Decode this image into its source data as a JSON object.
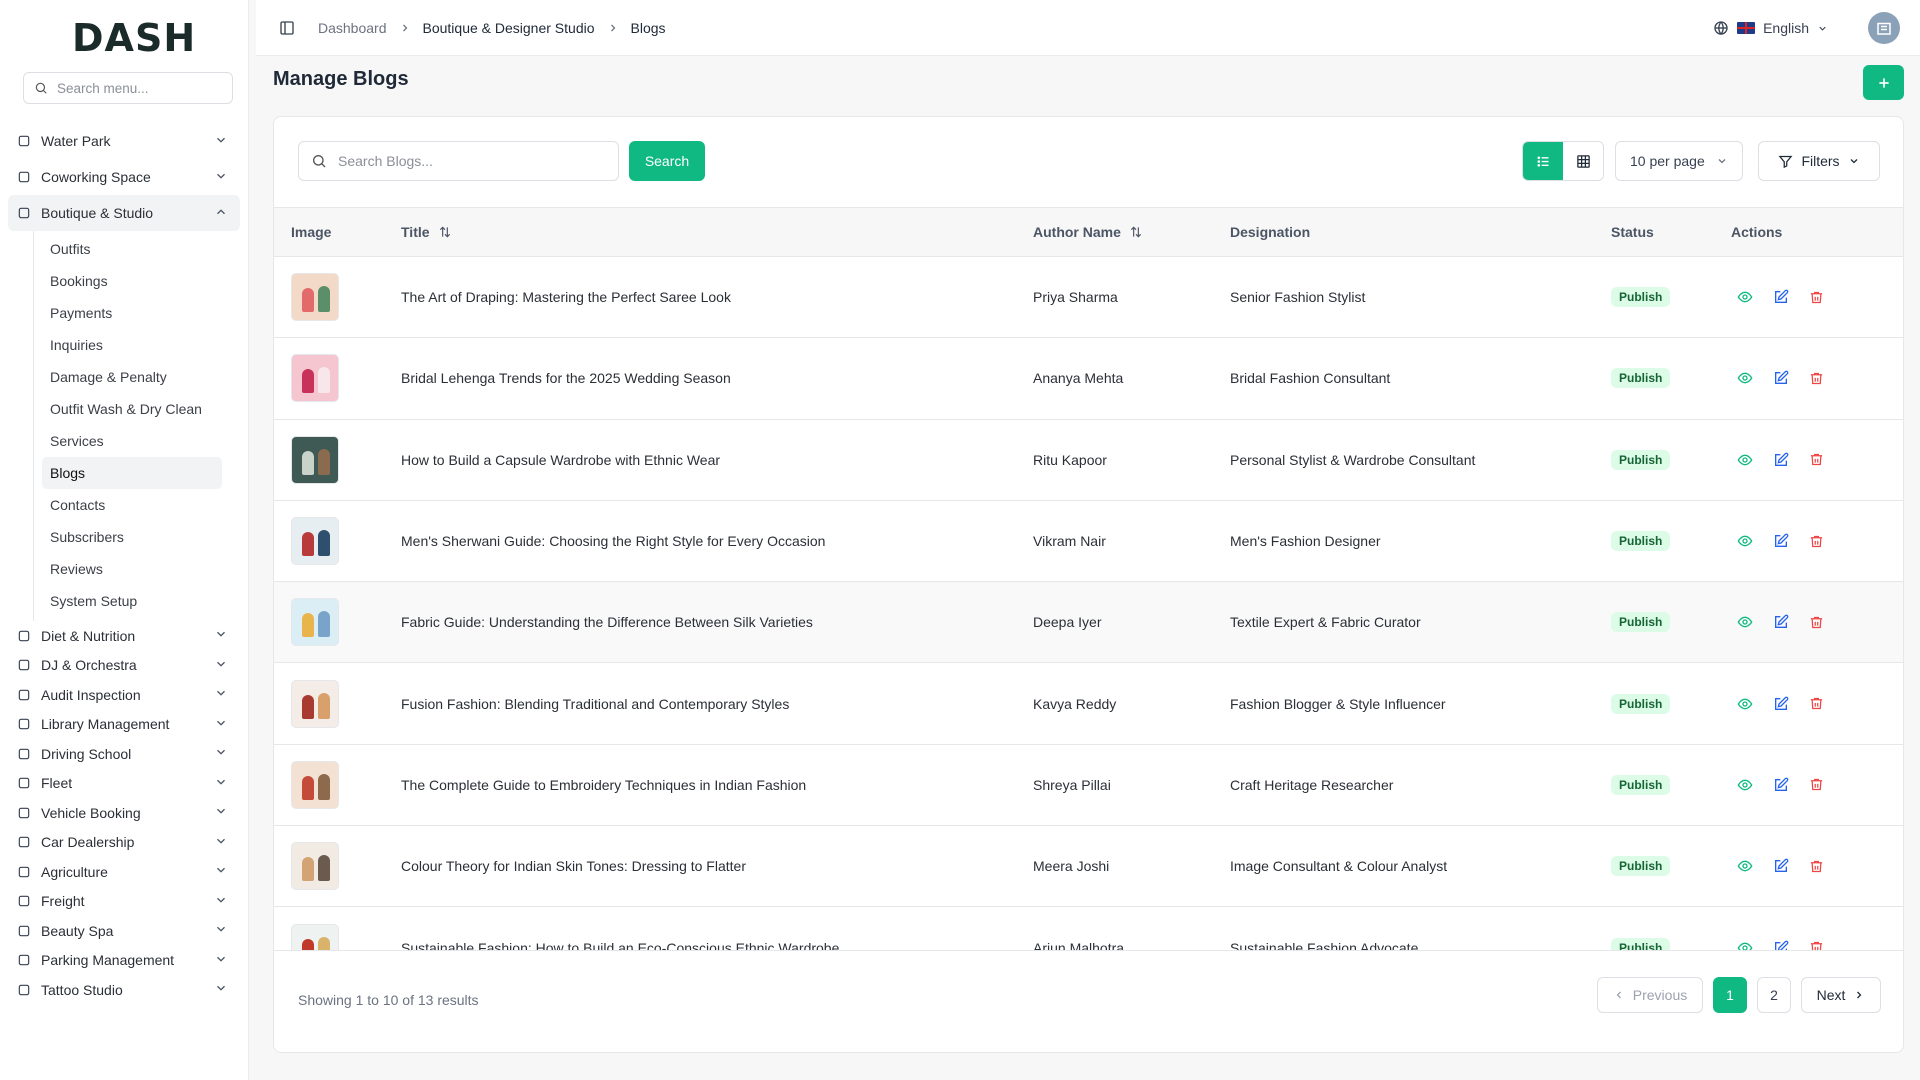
{
  "app": {
    "logo": "DASH"
  },
  "sidebar": {
    "search_placeholder": "Search menu...",
    "top_items": [
      {
        "label": "Water Park",
        "icon": "waves-icon"
      },
      {
        "label": "Coworking Space",
        "icon": "wifi-icon"
      }
    ],
    "active_group": {
      "label": "Boutique & Studio",
      "icon": "shirt-icon"
    },
    "sub_items": [
      {
        "label": "Outfits"
      },
      {
        "label": "Bookings"
      },
      {
        "label": "Payments"
      },
      {
        "label": "Inquiries"
      },
      {
        "label": "Damage & Penalty"
      },
      {
        "label": "Outfit Wash & Dry Clean"
      },
      {
        "label": "Services"
      },
      {
        "label": "Blogs"
      },
      {
        "label": "Contacts"
      },
      {
        "label": "Subscribers"
      },
      {
        "label": "Reviews"
      },
      {
        "label": "System Setup"
      }
    ],
    "bottom_items": [
      {
        "label": "Diet & Nutrition",
        "icon": "apple-icon"
      },
      {
        "label": "DJ & Orchestra",
        "icon": "disc-icon"
      },
      {
        "label": "Audit Inspection",
        "icon": "search-check-icon"
      },
      {
        "label": "Library Management",
        "icon": "library-icon"
      },
      {
        "label": "Driving School",
        "icon": "steering-wheel-icon"
      },
      {
        "label": "Fleet",
        "icon": "bus-icon"
      },
      {
        "label": "Vehicle Booking",
        "icon": "ticket-icon"
      },
      {
        "label": "Car Dealership",
        "icon": "car-icon"
      },
      {
        "label": "Agriculture",
        "icon": "tractor-icon"
      },
      {
        "label": "Freight",
        "icon": "container-icon"
      },
      {
        "label": "Beauty Spa",
        "icon": "scissors-icon"
      },
      {
        "label": "Parking Management",
        "icon": "grid-icon"
      },
      {
        "label": "Tattoo Studio",
        "icon": "pen-tool-icon"
      }
    ]
  },
  "topbar": {
    "breadcrumb": [
      "Dashboard",
      "Boutique & Designer Studio",
      "Blogs"
    ],
    "language": "English"
  },
  "page": {
    "title": "Manage Blogs",
    "add_label": "+"
  },
  "toolbar": {
    "search_placeholder": "Search Blogs...",
    "search_button": "Search",
    "per_page": "10 per page",
    "filters": "Filters"
  },
  "table": {
    "columns": [
      "Image",
      "Title",
      "Author Name",
      "Designation",
      "Status",
      "Actions"
    ],
    "rows": [
      {
        "title": "The Art of Draping: Mastering the Perfect Saree Look",
        "author": "Priya Sharma",
        "designation": "Senior Fashion Stylist",
        "status": "Publish",
        "thumb_colors": [
          "#f3d9c7",
          "#e36a6a",
          "#5b8f6a"
        ]
      },
      {
        "title": "Bridal Lehenga Trends for the 2025 Wedding Season",
        "author": "Ananya Mehta",
        "designation": "Bridal Fashion Consultant",
        "status": "Publish",
        "thumb_colors": [
          "#f5c6d0",
          "#c8325a",
          "#f7e7ea"
        ]
      },
      {
        "title": "How to Build a Capsule Wardrobe with Ethnic Wear",
        "author": "Ritu Kapoor",
        "designation": "Personal Stylist & Wardrobe Consultant",
        "status": "Publish",
        "thumb_colors": [
          "#3f5a54",
          "#c9d3c9",
          "#8b6b4f"
        ]
      },
      {
        "title": "Men's Sherwani Guide: Choosing the Right Style for Every Occasion",
        "author": "Vikram Nair",
        "designation": "Men's Fashion Designer",
        "status": "Publish",
        "thumb_colors": [
          "#e6eef2",
          "#b93a3a",
          "#2f4f6f"
        ]
      },
      {
        "title": "Fabric Guide: Understanding the Difference Between Silk Varieties",
        "author": "Deepa Iyer",
        "designation": "Textile Expert & Fabric Curator",
        "status": "Publish",
        "thumb_colors": [
          "#dbeef6",
          "#e9b44c",
          "#7aa3c9"
        ]
      },
      {
        "title": "Fusion Fashion: Blending Traditional and Contemporary Styles",
        "author": "Kavya Reddy",
        "designation": "Fashion Blogger & Style Influencer",
        "status": "Publish",
        "thumb_colors": [
          "#f4ece6",
          "#a83a2f",
          "#d8a06a"
        ]
      },
      {
        "title": "The Complete Guide to Embroidery Techniques in Indian Fashion",
        "author": "Shreya Pillai",
        "designation": "Craft Heritage Researcher",
        "status": "Publish",
        "thumb_colors": [
          "#f3e2d3",
          "#c44a3a",
          "#8c6a4b"
        ]
      },
      {
        "title": "Colour Theory for Indian Skin Tones: Dressing to Flatter",
        "author": "Meera Joshi",
        "designation": "Image Consultant & Colour Analyst",
        "status": "Publish",
        "thumb_colors": [
          "#f2ebe4",
          "#d4a373",
          "#6b5a4e"
        ]
      },
      {
        "title": "Sustainable Fashion: How to Build an Eco-Conscious Ethnic Wardrobe",
        "author": "Arjun Malhotra",
        "designation": "Sustainable Fashion Advocate",
        "status": "Publish",
        "thumb_colors": [
          "#eef2f0",
          "#c0392b",
          "#d9b36c"
        ]
      }
    ]
  },
  "footer": {
    "showing": "Showing 1 to 10 of 13 results",
    "prev": "Previous",
    "pages": [
      "1",
      "2"
    ],
    "next": "Next"
  },
  "colors": {
    "accent": "#10b981",
    "badge_bg": "#dcfce7",
    "delete": "#ef4444",
    "edit": "#2563eb",
    "view": "#10b981"
  }
}
